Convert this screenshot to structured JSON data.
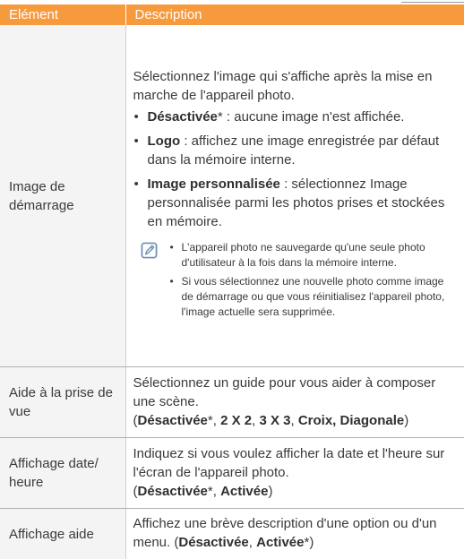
{
  "header": {
    "col_element": "Elément",
    "col_description": "Description"
  },
  "rows": [
    {
      "label": "Image de démarrage",
      "intro": "Sélectionnez l'image qui s'affiche après la mise en marche de l'appareil photo.",
      "options": [
        {
          "name": "Désactivée",
          "mark": "*",
          "text": " : aucune image n'est affichée."
        },
        {
          "name": "Logo",
          "mark": "",
          "text": " : affichez une image enregistrée par défaut dans la mémoire interne."
        },
        {
          "name": "Image personnalisée",
          "mark": "",
          "text": " : sélectionnez Image personnalisée parmi les photos prises et stockées en mémoire."
        }
      ],
      "notes": [
        "L'appareil photo ne sauvegarde qu'une seule photo d'utilisateur à la fois dans la mémoire interne.",
        "Si vous sélectionnez une nouvelle photo comme image de démarrage ou que vous réinitialisez l'appareil photo, l'image actuelle sera supprimée."
      ]
    },
    {
      "label": "Aide à la prise de vue",
      "text": "Sélectionnez un guide pour vous aider à composer une scène.",
      "values": {
        "open": "(",
        "v1": "Désactivée",
        "v1_mark": "*",
        "sep1": ", ",
        "v2": "2 X 2",
        "sep2": ", ",
        "v3": "3 X 3",
        "sep3": ", ",
        "v4": "Croix, Diagonale",
        "close": ")"
      }
    },
    {
      "label": "Affichage date/ heure",
      "text": "Indiquez si vous voulez afficher la date et l'heure sur l'écran de l'appareil photo.",
      "values": {
        "open": "(",
        "v1": "Désactivée",
        "v1_mark": "*",
        "sep1": ", ",
        "v2": "Activée",
        "close": ")"
      }
    },
    {
      "label": "Affichage aide",
      "text": "Affichez une brève description d'une option ou d'un menu. ",
      "values": {
        "open": "(",
        "v1": "Désactivée",
        "sep1": ", ",
        "v2": "Activée",
        "v2_mark": "*",
        "close": ")"
      }
    }
  ],
  "icons": {
    "note": "note-pencil-icon"
  },
  "colors": {
    "header_bg": "#f79a3e",
    "label_bg": "#f4f4f4",
    "note_icon": "#6b8fb3"
  }
}
